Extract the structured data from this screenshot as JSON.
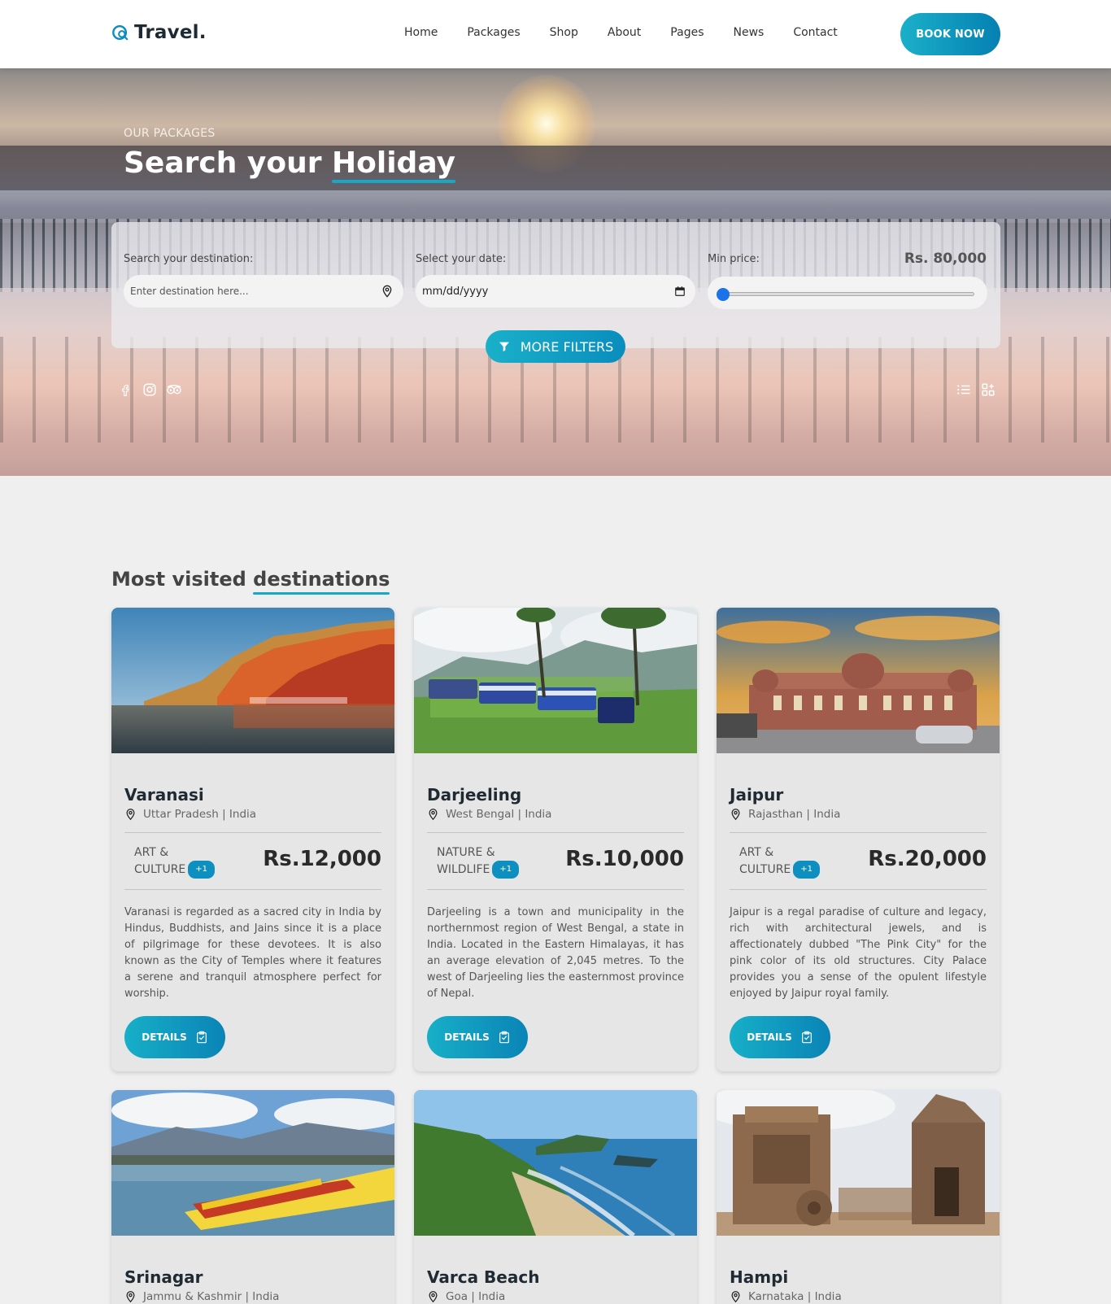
{
  "header": {
    "logo_text": "Travel.",
    "nav": [
      "Home",
      "Packages",
      "Shop",
      "About",
      "Pages",
      "News",
      "Contact"
    ],
    "book_label": "BOOK NOW"
  },
  "hero": {
    "kicker": "OUR PACKAGES",
    "title_plain": "Search your ",
    "title_highlight": "Holiday",
    "search": {
      "destination_label": "Search your destination:",
      "destination_placeholder": "Enter destination here...",
      "date_label": "Select your date:",
      "date_value": "mm/dd/yyyy",
      "price_label": "Min price:",
      "price_value": "Rs. 80,000",
      "price_slider_fraction": 0.02
    },
    "more_filters_label": "MORE FILTERS",
    "social_icons": [
      "facebook-icon",
      "instagram-icon",
      "tripadvisor-icon"
    ],
    "view_icons": [
      "list-view-icon",
      "grid-view-icon"
    ]
  },
  "section": {
    "title_plain": "Most visited ",
    "title_highlight": "destinations"
  },
  "cards": [
    {
      "name": "Varanasi",
      "location": "Uttar Pradesh | India",
      "category_line1": "ART &",
      "category_line2": "CULTURE",
      "plus": "+1",
      "price": "Rs.12,000",
      "description": "Varanasi is regarded as a sacred city in India by Hindus, Buddhists, and Jains since it is a place of pilgrimage for these devotees. It is also known as the City of Temples where it features a serene and tranquil atmosphere perfect for worship.",
      "details_label": "DETAILS"
    },
    {
      "name": "Darjeeling",
      "location": "West Bengal | India",
      "category_line1": "NATURE &",
      "category_line2": "WILDLIFE",
      "plus": "+1",
      "price": "Rs.10,000",
      "description": "Darjeeling is a town and municipality in the northernmost region of West Bengal, a state in India. Located in the Eastern Himalayas, it has an average elevation of 2,045 metres. To the west of Darjeeling lies the easternmost province of Nepal.",
      "details_label": "DETAILS"
    },
    {
      "name": "Jaipur",
      "location": "Rajasthan | India",
      "category_line1": "ART &",
      "category_line2": "CULTURE",
      "plus": "+1",
      "price": "Rs.20,000",
      "description": "Jaipur is a regal paradise of culture and legacy, rich with architectural jewels, and is affectionately dubbed \"The Pink City\" for the pink color of its old structures. City Palace provides you a sense of the opulent lifestyle enjoyed by Jaipur royal family.",
      "details_label": "DETAILS"
    },
    {
      "name": "Srinagar",
      "location": "Jammu & Kashmir | India"
    },
    {
      "name": "Varca Beach",
      "location": "Goa | India"
    },
    {
      "name": "Hampi",
      "location": "Karnataka | India"
    }
  ],
  "colors": {
    "accent": "#16a8c6",
    "accent_dark": "#0580b2",
    "background": "#efefef",
    "card": "#e6e6e6"
  }
}
